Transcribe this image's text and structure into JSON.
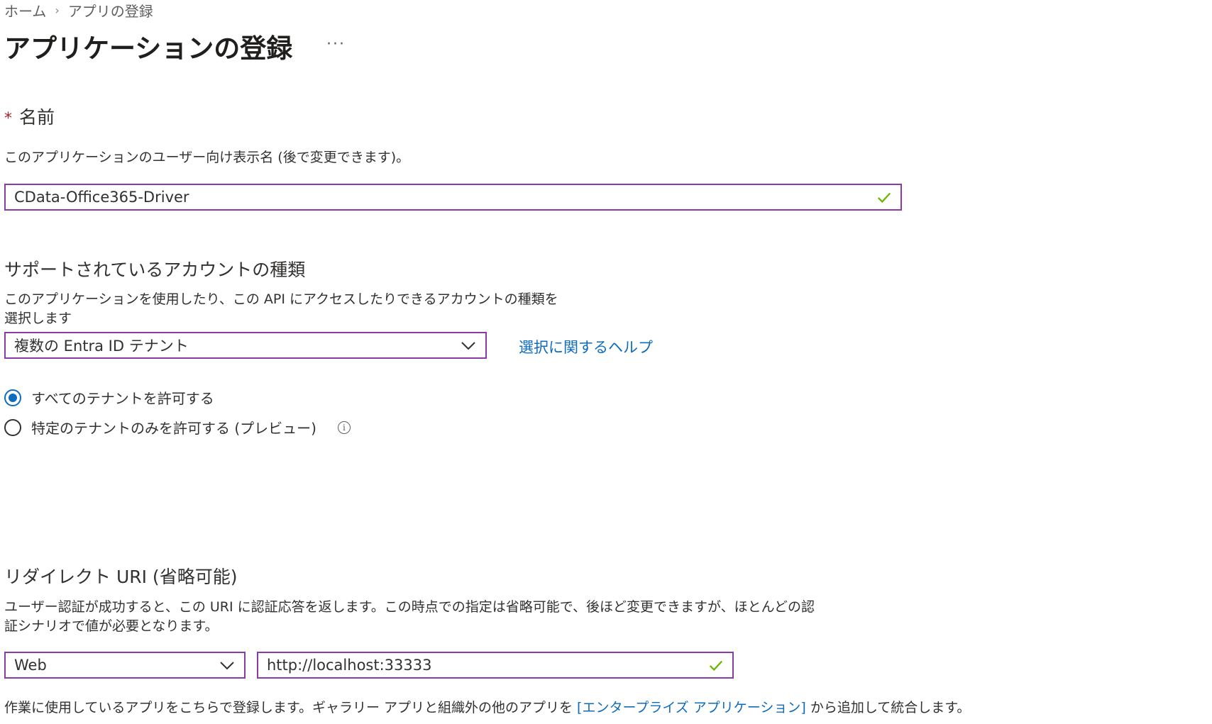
{
  "breadcrumb": {
    "home": "ホーム",
    "separator": "›",
    "current": "アプリの登録"
  },
  "page": {
    "title": "アプリケーションの登録",
    "more": "···"
  },
  "name_section": {
    "required_mark": "*",
    "label": "名前",
    "description": "このアプリケーションのユーザー向け表示名 (後で変更できます)。",
    "value": "CData-Office365-Driver"
  },
  "account_section": {
    "label": "サポートされているアカウントの種類",
    "description_line1": "このアプリケーションを使用したり、この API にアクセスしたりできるアカウントの種類を",
    "description_line2": "選択します",
    "selected": "複数の Entra ID テナント",
    "help_link": "選択に関するヘルプ",
    "radio_all": "すべてのテナントを許可する",
    "radio_specific": "特定のテナントのみを許可する (プレビュー)",
    "info_symbol": "i"
  },
  "redirect_section": {
    "label": "リダイレクト URI (省略可能)",
    "description_line1": "ユーザー認証が成功すると、この URI に認証応答を返します。この時点での指定は省略可能で、後ほど変更できますが、ほとんどの認",
    "description_line2": "証シナリオで値が必要となります。",
    "platform": "Web",
    "uri": "http://localhost:33333"
  },
  "footer": {
    "text_before": "作業に使用しているアプリをこちらで登録します。ギャラリー アプリと組織外の他のアプリを ",
    "link": "[エンタープライズ アプリケーション]",
    "text_after": " から追加して統合します。"
  },
  "colors": {
    "accent": "#0f6cbd",
    "focus_border": "#8c3aa6",
    "valid_check": "#6bb700",
    "required": "#a4262c"
  }
}
